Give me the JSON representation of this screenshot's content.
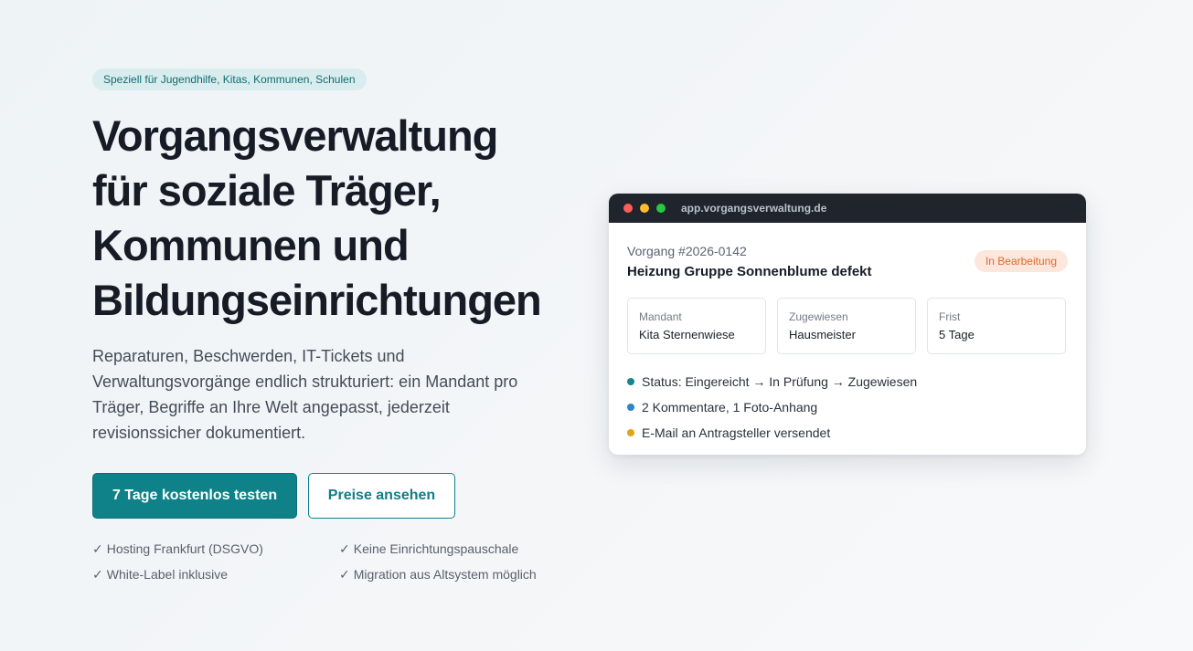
{
  "hero": {
    "pill": "Speziell für Jugendhilfe, Kitas, Kommunen, Schulen",
    "headline": [
      "Vorgangsverwaltung",
      "für soziale Träger,",
      "Kommunen und",
      "Bildungseinrichtungen"
    ],
    "lead": [
      "Reparaturen, Beschwerden, IT-Tickets und",
      "Verwaltungsvorgänge endlich strukturiert: ein Mandant pro",
      "Träger, Begriffe an Ihre Welt angepasst, jederzeit",
      "revisionssicher dokumentiert."
    ],
    "primary_cta": "7 Tage kostenlos testen",
    "secondary_cta": "Preise ansehen",
    "check_glyph": "✓",
    "features": [
      "Hosting Frankfurt (DSGVO)",
      "Keine Einrichtungspauschale",
      "White-Label inklusive",
      "Migration aus Altsystem möglich"
    ]
  },
  "mock": {
    "url": "app.vorgangsverwaltung.de",
    "window_dots": [
      "#ff5f57",
      "#febc2e",
      "#28c840"
    ],
    "case_id": "Vorgang #2026-0142",
    "case_title": "Heizung Gruppe Sonnenblume defekt",
    "status_badge": "In Bearbeitung",
    "cards": [
      {
        "label": "Mandant",
        "value": "Kita Sternenwiese"
      },
      {
        "label": "Zugewiesen",
        "value": "Hausmeister"
      },
      {
        "label": "Frist",
        "value": "5 Tage"
      }
    ],
    "events": [
      {
        "text": "Status: Eingereicht → In Prüfung → Zugewiesen",
        "color": "#12898e"
      },
      {
        "text": "2 Kommentare, 1 Foto-Anhang",
        "color": "#2f86c9"
      },
      {
        "text": "E-Mail an Antragsteller versendet",
        "color": "#e0a512"
      }
    ]
  }
}
